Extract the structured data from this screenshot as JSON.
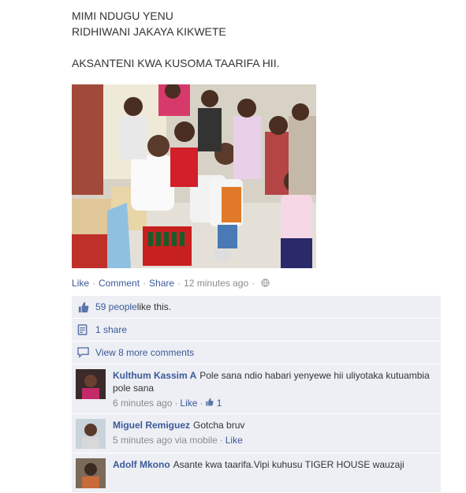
{
  "post": {
    "lines": [
      "MIMI NDUGU YENU",
      "RIDHIWANI JAKAYA KIKWETE",
      "AKSANTENI KWA KUSOMA TAARIFA HII."
    ]
  },
  "actions": {
    "like": "Like",
    "comment": "Comment",
    "share": "Share",
    "time": "12 minutes ago",
    "sep": "·"
  },
  "likes": {
    "count_text": "59 people",
    "suffix": " like this."
  },
  "shares": {
    "text": "1 share"
  },
  "more_comments": {
    "text": "View 8 more comments"
  },
  "comments": [
    {
      "name": "Kulthum Kassim A",
      "text": "Pole sana ndio habari yenyewe hii uliyotaka kutuambia pole sana",
      "time": "6 minutes ago",
      "like": "Like",
      "likes": "1"
    },
    {
      "name": "Miguel Remiguez",
      "text": "Gotcha bruv",
      "time": "5 minutes ago via mobile",
      "like": "Like"
    },
    {
      "name": "Adolf Mkono",
      "text": "Asante kwa taarifa.Vipi kuhusu TIGER HOUSE wauzaji"
    }
  ],
  "colors": {
    "link": "#3b5998",
    "panel": "#edeff4"
  }
}
